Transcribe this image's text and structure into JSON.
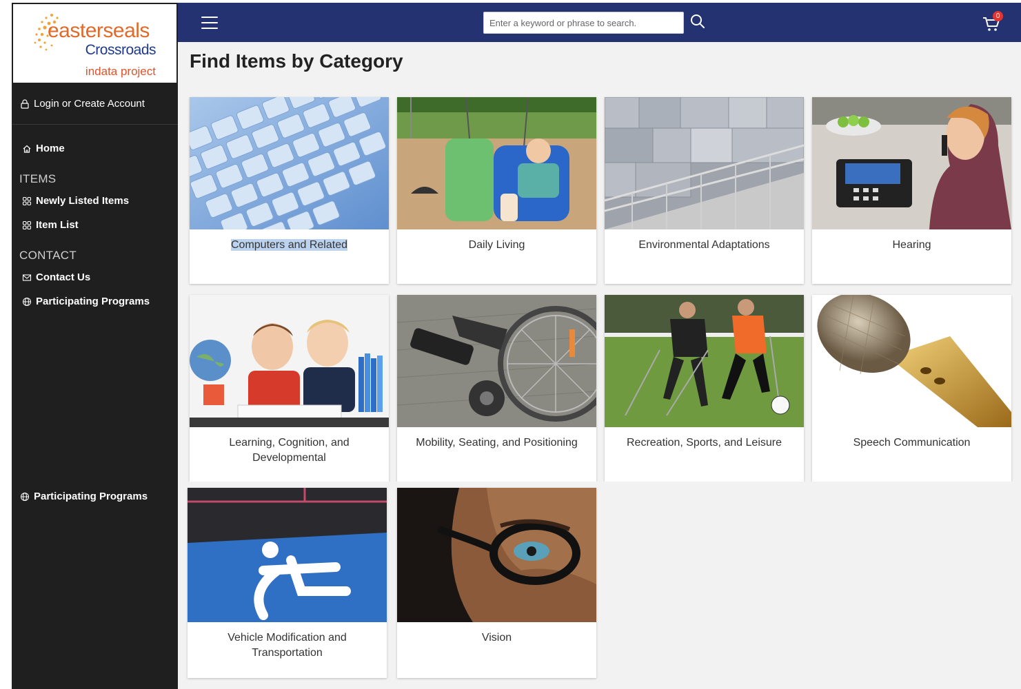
{
  "brand": {
    "name": "easterseals",
    "sub": "Crossroads",
    "tagline": "indata project",
    "colors": {
      "orange": "#e06a2b",
      "blue": "#1f3a8a"
    }
  },
  "sidebar": {
    "login": "Login or Create Account",
    "home": "Home",
    "items_header": "ITEMS",
    "items": [
      {
        "label": "Newly Listed Items",
        "icon": "grid-icon"
      },
      {
        "label": "Item List",
        "icon": "grid-icon"
      }
    ],
    "contact_header": "CONTACT",
    "contact": [
      {
        "label": "Contact Us",
        "icon": "envelope-icon"
      },
      {
        "label": "Participating Programs",
        "icon": "globe-icon"
      }
    ],
    "programs_repeat": "Participating Programs"
  },
  "header": {
    "search_placeholder": "Enter a keyword or phrase to search.",
    "cart_count": "0",
    "bar_color": "#253272"
  },
  "main": {
    "title": "Find Items by Category",
    "categories": [
      {
        "label": "Computers and Related",
        "image": "keyboard"
      },
      {
        "label": "Daily Living",
        "image": "swing"
      },
      {
        "label": "Environmental Adaptations",
        "image": "ramp"
      },
      {
        "label": "Hearing",
        "image": "phone"
      },
      {
        "label": "Learning, Cognition, and Developmental",
        "image": "children"
      },
      {
        "label": "Mobility, Seating, and Positioning",
        "image": "wheelchair"
      },
      {
        "label": "Recreation, Sports, and Leisure",
        "image": "soccer"
      },
      {
        "label": "Speech Communication",
        "image": "microphone"
      },
      {
        "label": "Vehicle Modification and Transportation",
        "image": "parking"
      },
      {
        "label": "Vision",
        "image": "glasses"
      }
    ]
  }
}
